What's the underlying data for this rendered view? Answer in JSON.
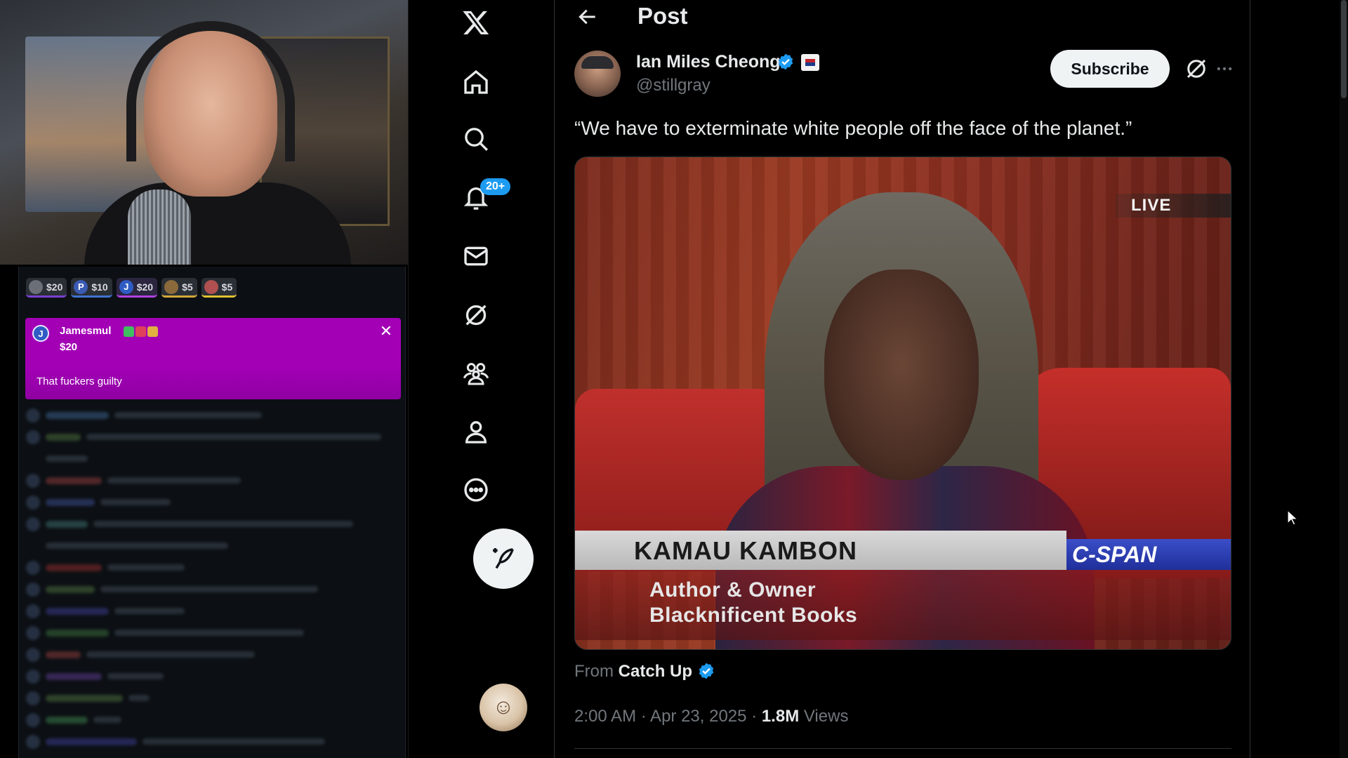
{
  "stream": {
    "donation_chips": [
      {
        "initial": "",
        "amount": "$20"
      },
      {
        "initial": "P",
        "amount": "$10"
      },
      {
        "initial": "J",
        "amount": "$20"
      },
      {
        "initial": "",
        "amount": "$5"
      },
      {
        "initial": "",
        "amount": "$5"
      }
    ],
    "highlight": {
      "avatar_initial": "J",
      "name": "Jamesmul",
      "amount": "$20",
      "message": "That fuckers guilty",
      "close_glyph": "✕",
      "color": "#a300b6"
    }
  },
  "x": {
    "logo": "X",
    "page_title": "Post",
    "notifications_badge": "20+",
    "nav": [
      "home-icon",
      "search-icon",
      "bell-icon",
      "mail-icon",
      "grok-icon",
      "communities-icon",
      "profile-icon",
      "more-circle-icon"
    ],
    "post": {
      "author_name": "Ian Miles Cheong",
      "author_handle": "@stillgray",
      "subscribe_label": "Subscribe",
      "text": "“We have to exterminate white people off the face of the planet.”",
      "video": {
        "live_bug": "LIVE",
        "lower_third_name": "KAMAU KAMBON",
        "lower_third_network": "C-SPAN",
        "lower_third_line1": "Author & Owner",
        "lower_third_line2": "Blacknificent Books"
      },
      "from_prefix": "From",
      "from_source": "Catch Up",
      "timestamp": "2:00 AM · Apr 23, 2025 · ",
      "views_count": "1.8M",
      "views_label": " Views"
    },
    "colors": {
      "accent": "#1d9bf0",
      "text": "#e7e9ea",
      "muted": "#71767b",
      "border": "#2f3336"
    }
  }
}
